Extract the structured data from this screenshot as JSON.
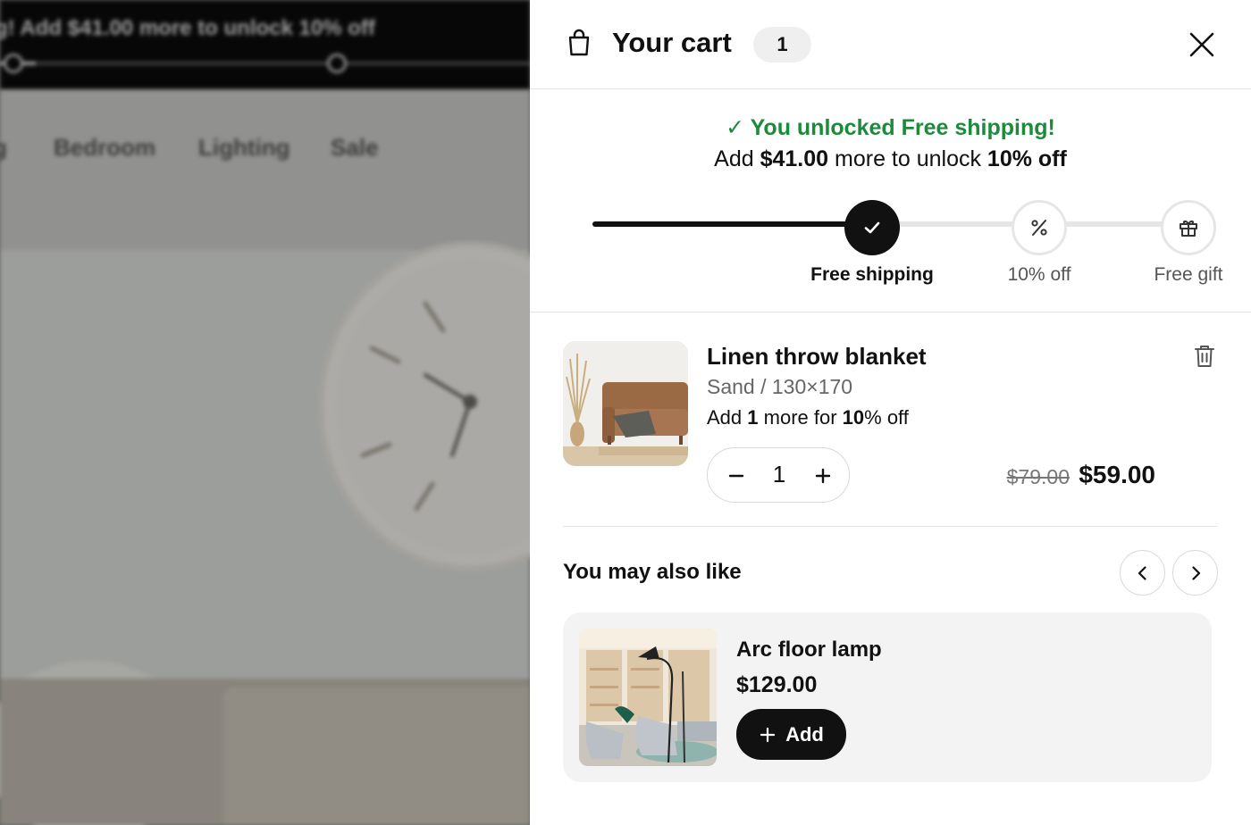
{
  "background": {
    "announcement": "g! Add $41.00 more to unlock 10% off",
    "nav_items": [
      "g",
      "Bedroom",
      "Lighting",
      "Sale"
    ]
  },
  "cart": {
    "title": "Your cart",
    "count": "1",
    "icons": {
      "bag": "shopping-bag-icon",
      "close": "close-icon"
    }
  },
  "rewards": {
    "unlocked_message": "✓ You unlocked Free shipping!",
    "next_prefix": "Add ",
    "next_amount": "$41.00",
    "next_middle": " more to unlock ",
    "next_reward": "10% off",
    "progress": 0.47,
    "milestones": [
      {
        "label": "Free shipping",
        "state": "done",
        "icon": "check-icon"
      },
      {
        "label": "10% off",
        "state": "todo",
        "icon": "percent-icon"
      },
      {
        "label": "Free gift",
        "state": "todo",
        "icon": "gift-icon"
      }
    ]
  },
  "line_item": {
    "name": "Linen throw blanket",
    "variant": "Sand / 130×170",
    "promo_prefix": "Add ",
    "promo_qty": "1",
    "promo_middle": " more for ",
    "promo_pct": "10",
    "promo_suffix": "% off",
    "quantity": "1",
    "compare_price": "$79.00",
    "price": "$59.00"
  },
  "upsell": {
    "title": "You may also like",
    "product": {
      "name": "Arc floor lamp",
      "price": "$129.00",
      "add_label": "Add"
    }
  },
  "colors": {
    "success": "#1e8a3c",
    "primary": "#111111",
    "track": "#e6e6e6"
  }
}
